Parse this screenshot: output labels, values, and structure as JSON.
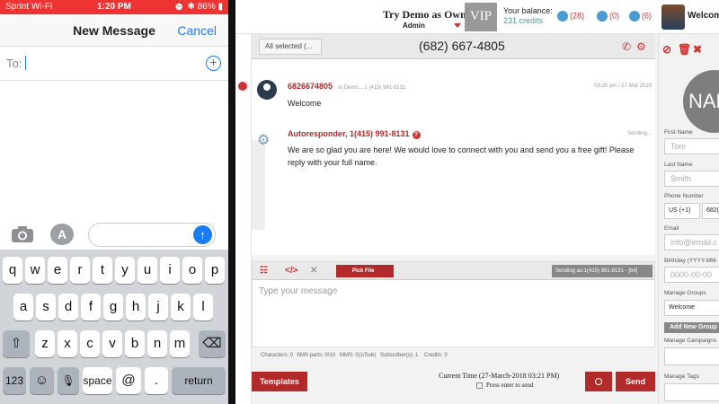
{
  "phone": {
    "status": {
      "carrier": "Sprint Wi-Fi",
      "time": "1:20 PM",
      "right": "⏰ ✱ 86% ▮"
    },
    "nav": {
      "title": "New Message",
      "cancel": "Cancel"
    },
    "to_label": "To:",
    "keyboard": {
      "row1": [
        "q",
        "w",
        "e",
        "r",
        "t",
        "y",
        "u",
        "i",
        "o",
        "p"
      ],
      "row2": [
        "a",
        "s",
        "d",
        "f",
        "g",
        "h",
        "j",
        "k",
        "l"
      ],
      "row3": [
        "z",
        "x",
        "c",
        "v",
        "b",
        "n",
        "m"
      ],
      "bottom": {
        "num": "123",
        "emoji": "☺",
        "mic": "🎤",
        "space": "space",
        "at": "@",
        "dot": ".",
        "return": "return"
      }
    }
  },
  "app": {
    "header": {
      "try_demo": "Try Demo as Owner",
      "admin": "Admin",
      "vip": "VIP",
      "balance_label": "Your balance:",
      "credits": "231 credits",
      "contacts_count": "(28)",
      "messages_count": "(0)",
      "alerts_count": "(6)",
      "welcome": "Welcom"
    },
    "toolbar": {
      "all_selected": "All selected (...",
      "phone": "(682) 667-4805"
    },
    "messages": [
      {
        "sender": "6826674805",
        "to": "to Demo... 1 (415) 991-8131",
        "meta": "03:20 pm / 27 Mar 2018",
        "text": "Welcome"
      },
      {
        "sender": "Autoresponder, 1(415) 991-8131",
        "meta": "Sending...",
        "text": "We are so glad you are here! We would love to connect with you and send you a free gift! Please reply with your full name."
      }
    ],
    "composer": {
      "pick_file": "Pick File",
      "sending_as": "Sending as:1(415) 991-8131 - [b4]",
      "placeholder": "Type your message"
    },
    "counts": {
      "characters": "Characters: 0",
      "sms_parts": "SMS parts: 0/10",
      "mms": "MMS: 0(1/Sub)",
      "subscribers": "Subscriber(s): 1",
      "credits": "Credits: 0"
    },
    "footer": {
      "templates": "Templates",
      "current_time": "Current Time (27-March-2018 03:21 PM)",
      "press_enter": "Press enter to send",
      "send": "Send"
    },
    "right_panel": {
      "avatar_text": "NAM",
      "first_name_label": "First Name",
      "first_name": "Tom",
      "last_name_label": "Last Name",
      "last_name": "Smith",
      "phone_label": "Phone Number",
      "country": "US (+1)",
      "phone_value": "682(",
      "email_label": "Email",
      "email_ph": "info@email.c",
      "birthday_label": "Birthday (YYYY-MM-",
      "birthday_ph": "0000-00-00",
      "groups_label": "Manage Groups",
      "group_value": "Welcome",
      "add_group": "Add New Group",
      "campaigns_label": "Manage Campaigns",
      "tags_label": "Manage Tags"
    }
  },
  "colors": {
    "accent_red": "#b32a2a",
    "ios_blue": "#1a7bf2",
    "status_red": "#e33"
  }
}
